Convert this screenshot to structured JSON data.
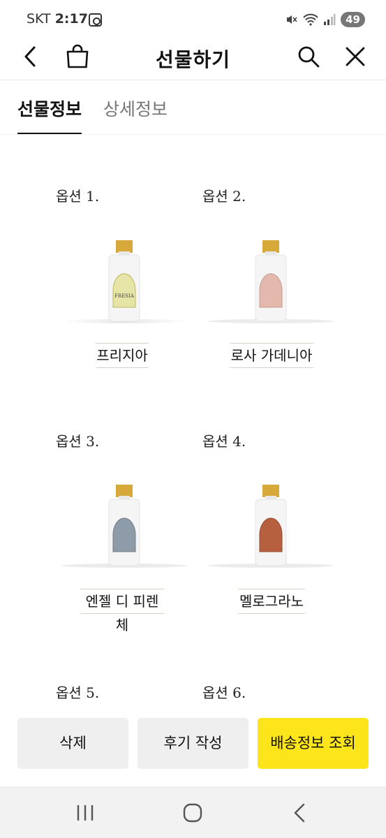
{
  "status_bar": {
    "carrier": "SKT",
    "time": "2:17",
    "battery": "49"
  },
  "header": {
    "title": "선물하기"
  },
  "tabs": [
    {
      "label": "선물정보",
      "active": true
    },
    {
      "label": "상세정보",
      "active": false
    }
  ],
  "options": [
    {
      "label": "옵션 1.",
      "name": "프리지아",
      "label_color": "#e6e4a6",
      "bottle_label_text": "FRESIA"
    },
    {
      "label": "옵션 2.",
      "name": "로사 가데니아",
      "label_color": "#e3b9ae"
    },
    {
      "label": "옵션 3.",
      "name": "엔젤 디 피렌체",
      "label_color": "#8e9ba8"
    },
    {
      "label": "옵션 4.",
      "name": "멜로그라노",
      "label_color": "#b6603f"
    },
    {
      "label": "옵션 5."
    },
    {
      "label": "옵션 6."
    }
  ],
  "actions": {
    "delete": "삭제",
    "review": "후기 작성",
    "delivery": "배송정보 조회",
    "delivery_color": "#fce51b"
  },
  "icons": {
    "back": "chevron-left-icon",
    "bag": "shopping-bag-icon",
    "search": "search-icon",
    "close": "close-icon",
    "nav_recent": "recent-apps-icon",
    "nav_home": "home-icon",
    "nav_back": "back-icon"
  }
}
